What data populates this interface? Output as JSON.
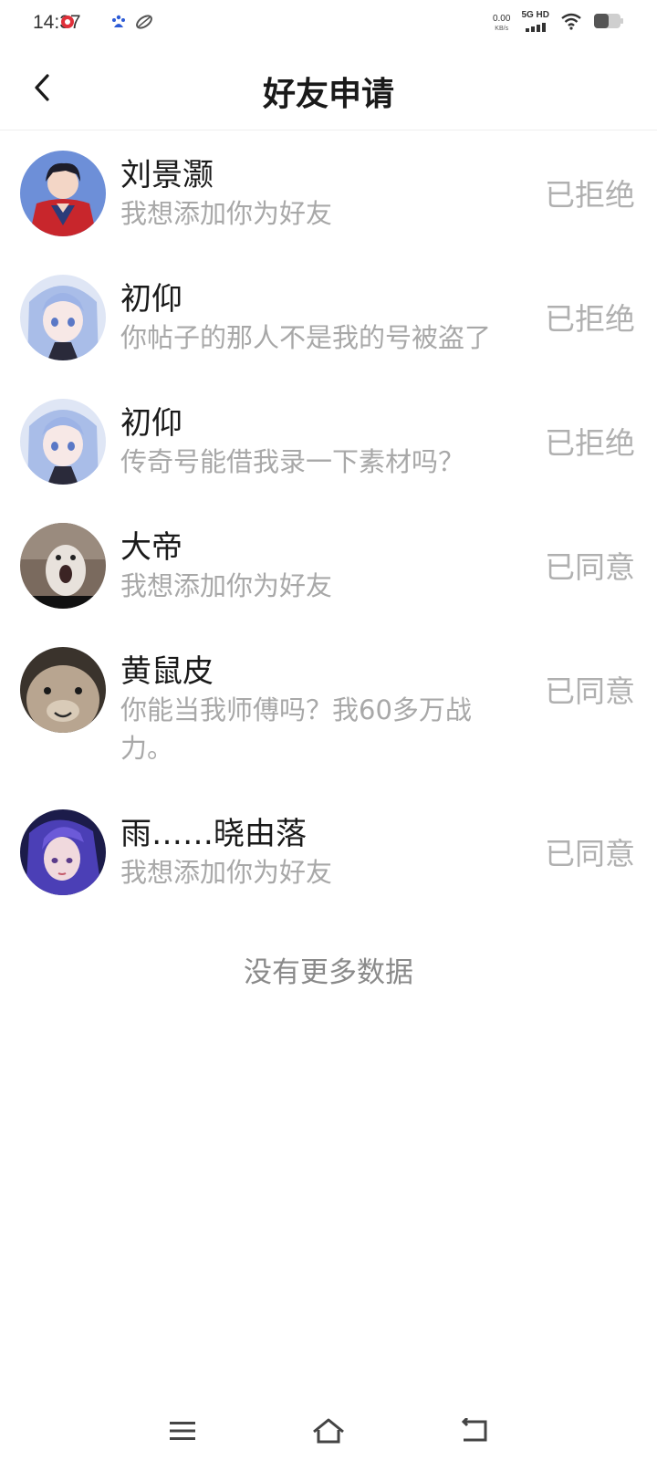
{
  "status_bar": {
    "time": "14:37",
    "net_speed_value": "0.00",
    "net_speed_unit": "KB/s",
    "signal_label": "5G HD",
    "icons": [
      "notification-red-icon",
      "baidu-icon",
      "leaf-icon",
      "signal-icon",
      "wifi-icon",
      "battery-icon"
    ]
  },
  "header": {
    "title": "好友申请",
    "back_icon": "chevron-left-icon"
  },
  "requests": [
    {
      "name": "刘景灏",
      "message": "我想添加你为好友",
      "status": "已拒绝",
      "avatar": "anime-man-red-collar"
    },
    {
      "name": "初仰",
      "message": "你帖子的那人不是我的号被盗了",
      "status": "已拒绝",
      "avatar": "anime-girl-blue-hair"
    },
    {
      "name": "初仰",
      "message": "传奇号能借我录一下素材吗？",
      "status": "已拒绝",
      "avatar": "anime-girl-blue-hair"
    },
    {
      "name": "大帝",
      "message": "我想添加你为好友",
      "status": "已同意",
      "avatar": "screaming-cat"
    },
    {
      "name": "黄鼠皮",
      "message": "你能当我师傅吗？我60多万战力。",
      "status": "已同意",
      "avatar": "smiling-animal"
    },
    {
      "name": "雨……晓由落",
      "message": "我想添加你为好友",
      "status": "已同意",
      "avatar": "fantasy-girl-purple"
    }
  ],
  "footer_text": "没有更多数据",
  "nav": {
    "menu_icon": "menu-icon",
    "home_icon": "home-icon",
    "back_icon": "back-icon"
  },
  "colors": {
    "title": "#1a1a1a",
    "name": "#1a1a1a",
    "message": "#a8a8a8",
    "status": "#b0b0b0",
    "footer": "#8a8a8a"
  }
}
